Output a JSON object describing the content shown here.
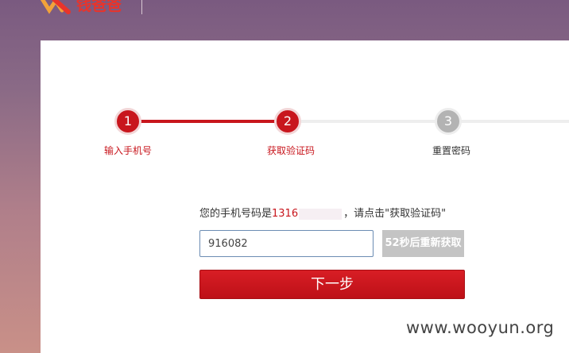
{
  "header": {
    "logo_text": "钱爸爸"
  },
  "steps": [
    {
      "number": "1",
      "label": "输入手机号",
      "state": "done"
    },
    {
      "number": "2",
      "label": "获取验证码",
      "state": "current"
    },
    {
      "number": "3",
      "label": "重置密码",
      "state": "pending"
    }
  ],
  "verify": {
    "phone_prefix": "您的手机号码是",
    "phone_number": "1316",
    "phone_suffix": "，请点击\"获取验证码\"",
    "code_value": "916082",
    "resend_label": "52秒后重新获取",
    "next_label": "下一步"
  },
  "watermark": "www.wooyun.org",
  "colors": {
    "accent": "#c8161d",
    "inactive": "#b3b3b3"
  }
}
